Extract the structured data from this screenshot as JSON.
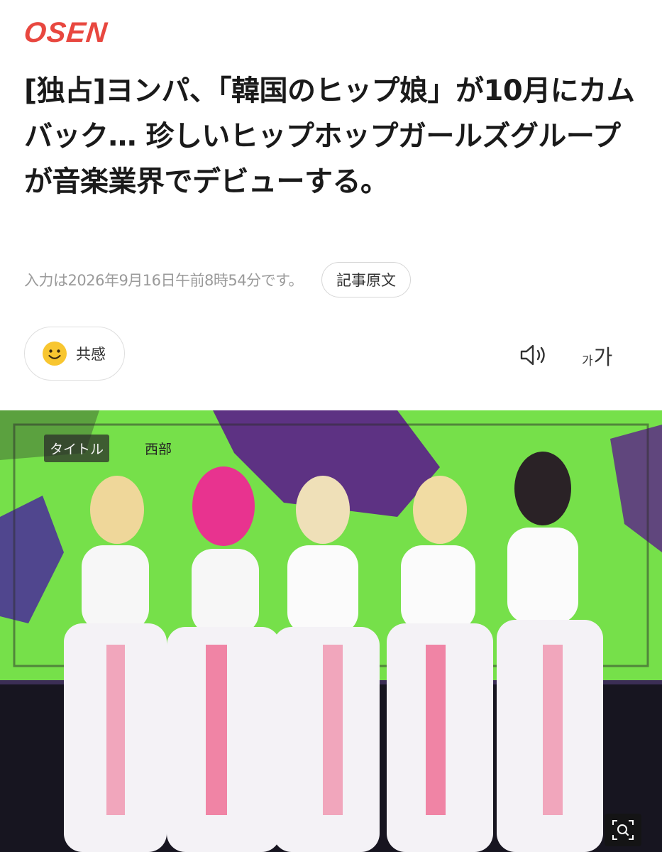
{
  "brand": {
    "logo_text": "OSEN",
    "color": "#e8473f"
  },
  "article": {
    "headline": "[独占]ヨンパ、「韓国のヒップ娘」が10月にカムバック… 珍しいヒップホップガールズグループが音楽業界でデビューする。",
    "date_text": "入力は2026年9月16日午前8時54分です。",
    "original_button_label": "記事原文"
  },
  "actions": {
    "empathy_label": "共感",
    "empathy_icon": "smiley-face-icon",
    "speaker_icon": "speaker-icon",
    "font_size_small": "가",
    "font_size_big": "가"
  },
  "photo": {
    "description_icon": "photo",
    "tag_left": "タイトル",
    "tag_right": "西部",
    "zoom_icon": "zoom-icon"
  }
}
